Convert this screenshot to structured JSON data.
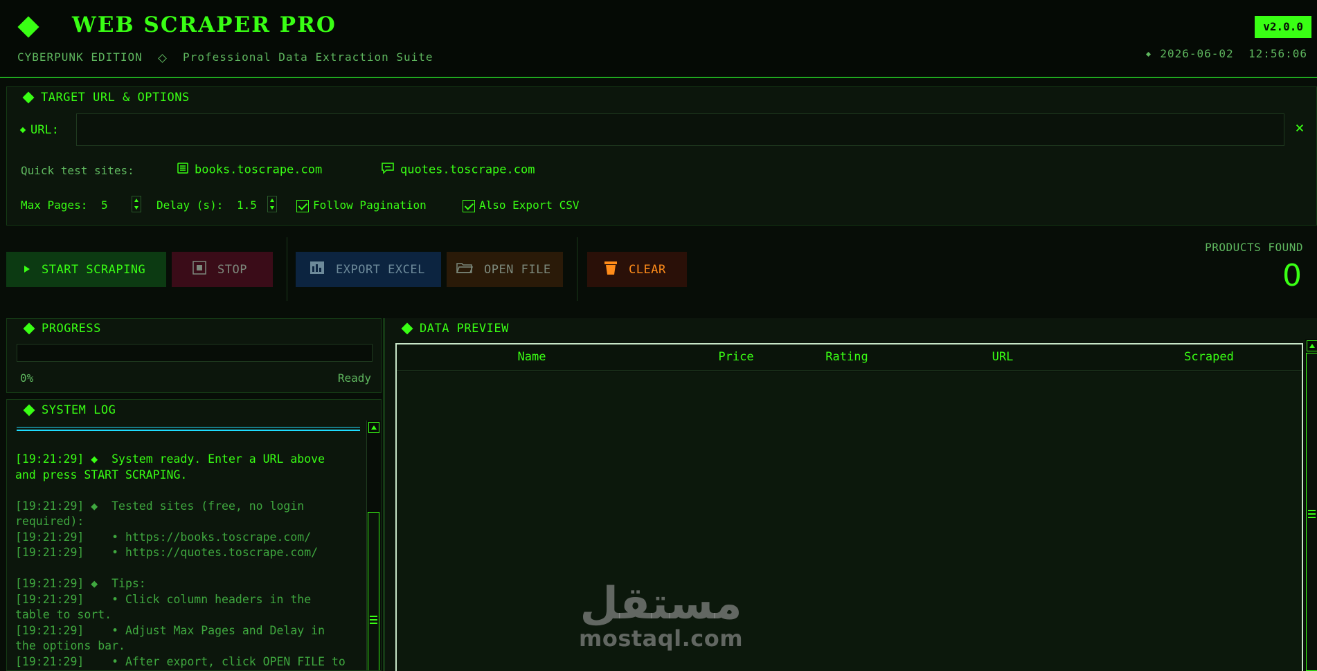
{
  "header": {
    "title": "WEB SCRAPER PRO",
    "edition": "CYBERPUNK EDITION",
    "tagline": "Professional Data Extraction Suite",
    "version": "v2.0.0",
    "datetime": "2026-06-02  12:56:06"
  },
  "options": {
    "section_title": "TARGET URL & OPTIONS",
    "url_label": "URL:",
    "url_value": "",
    "url_placeholder": "",
    "clear_icon": "×",
    "quick_label": "Quick test sites:",
    "quick_sites": [
      {
        "label": "books.toscrape.com",
        "icon": "book-icon"
      },
      {
        "label": "quotes.toscrape.com",
        "icon": "chat-icon"
      }
    ],
    "max_pages_label": "Max Pages:",
    "max_pages_value": "5",
    "delay_label": "Delay (s):",
    "delay_value": "1.5",
    "follow_pagination": {
      "label": "Follow Pagination",
      "checked": true
    },
    "export_csv": {
      "label": "Also Export CSV",
      "checked": true
    }
  },
  "toolbar": {
    "start_label": "START SCRAPING",
    "stop_label": "STOP",
    "export_label": "EXPORT EXCEL",
    "open_label": "OPEN FILE",
    "clear_label": "CLEAR",
    "products_label": "PRODUCTS FOUND",
    "products_count": "0"
  },
  "progress": {
    "title": "PROGRESS",
    "percent_text": "0%",
    "percent_value": 0,
    "status": "Ready"
  },
  "log": {
    "title": "SYSTEM LOG",
    "lines": [
      {
        "text": "[19:21:29] ◆  System ready. Enter a URL above\nand press START SCRAPING.",
        "bright": true
      },
      {
        "text": "",
        "gap": true
      },
      {
        "text": "[19:21:29] ◆  Tested sites (free, no login\nrequired):",
        "bright": false
      },
      {
        "text": "[19:21:29]    • https://books.toscrape.com/",
        "bright": false
      },
      {
        "text": "[19:21:29]    • https://quotes.toscrape.com/",
        "bright": false
      },
      {
        "text": "",
        "gap": true
      },
      {
        "text": "[19:21:29] ◆  Tips:",
        "bright": false
      },
      {
        "text": "[19:21:29]    • Click column headers in the\ntable to sort.",
        "bright": false
      },
      {
        "text": "[19:21:29]    • Adjust Max Pages and Delay in\nthe options bar.",
        "bright": false
      },
      {
        "text": "[19:21:29]    • After export, click OPEN FILE to",
        "bright": false
      }
    ]
  },
  "preview": {
    "title": "DATA PREVIEW",
    "columns": [
      "Name",
      "Price",
      "Rating",
      "URL",
      "Scraped"
    ],
    "rows": []
  },
  "watermark": {
    "arabic": "مستقل",
    "latin": "mostaql.com"
  },
  "colors": {
    "accent": "#39ff14",
    "background": "#070d07",
    "start_bg": "#0c3a12",
    "stop_bg": "#3a0c18",
    "export_bg": "#0c2440",
    "open_bg": "#2a1a08",
    "clear_bg": "#2a1008",
    "clear_fg": "#ff8c1a",
    "log_bar": "#1fdcff"
  }
}
